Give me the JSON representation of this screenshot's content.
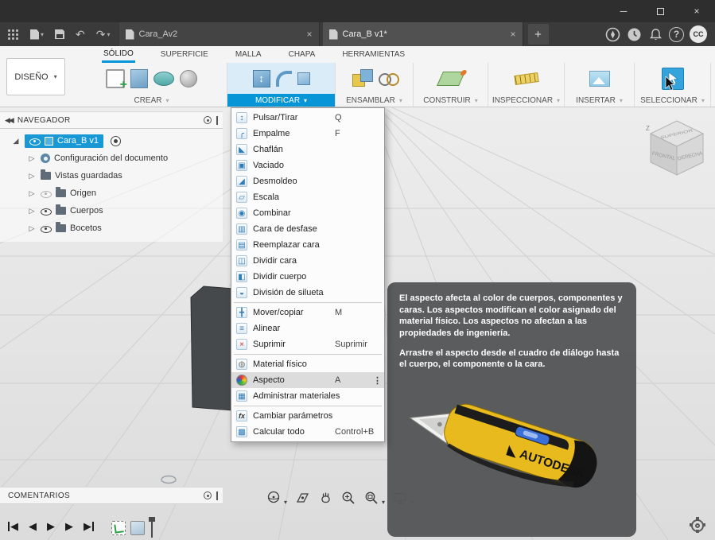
{
  "icons": {
    "caret": "▾",
    "close": "×",
    "minimize": "─",
    "new_tab": "+",
    "undo": "↶",
    "redo": "↷",
    "help": "?",
    "overflow": "⋮",
    "collapse": "◀◀",
    "play": "▶",
    "rewind": "◀"
  },
  "tabbar": {
    "tabs": [
      {
        "label": "Cara_Av2",
        "active": false
      },
      {
        "label": "Cara_B v1*",
        "active": true
      }
    ],
    "avatar": "CC"
  },
  "ribbon": {
    "design_button": "DISEÑO",
    "tabs": [
      "SÓLIDO",
      "SUPERFICIE",
      "MALLA",
      "CHAPA",
      "HERRAMIENTAS"
    ],
    "active_tab": "SÓLIDO",
    "groups": [
      {
        "label": "CREAR"
      },
      {
        "label": "MODIFICAR",
        "active": true
      },
      {
        "label": "ENSAMBLAR"
      },
      {
        "label": "CONSTRUIR"
      },
      {
        "label": "INSPECCIONAR"
      },
      {
        "label": "INSERTAR"
      },
      {
        "label": "SELECCIONAR"
      }
    ],
    "accent_color": "#0696d7"
  },
  "navigator": {
    "title": "NAVEGADOR",
    "items": [
      {
        "label": "Cara_B v1",
        "icon": "component-icon",
        "eye": "on",
        "selected": true,
        "radio": true,
        "expander": "expanded"
      },
      {
        "label": "Configuración del documento",
        "icon": "gear-icon",
        "eye": "none",
        "expander": "collapsed"
      },
      {
        "label": "Vistas guardadas",
        "icon": "folder-icon",
        "eye": "none",
        "expander": "collapsed"
      },
      {
        "label": "Origen",
        "icon": "folder-icon",
        "eye": "off",
        "expander": "collapsed"
      },
      {
        "label": "Cuerpos",
        "icon": "folder-icon",
        "eye": "on",
        "expander": "collapsed"
      },
      {
        "label": "Bocetos",
        "icon": "folder-icon",
        "eye": "on",
        "expander": "collapsed"
      }
    ]
  },
  "modify_menu": {
    "items": [
      {
        "label": "Pulsar/Tirar",
        "shortcut": "Q",
        "icon": "press-pull-icon"
      },
      {
        "label": "Empalme",
        "shortcut": "F",
        "icon": "fillet-icon"
      },
      {
        "label": "Chaflán",
        "icon": "chamfer-icon"
      },
      {
        "label": "Vaciado",
        "icon": "shell-icon"
      },
      {
        "label": "Desmoldeo",
        "icon": "draft-icon"
      },
      {
        "label": "Escala",
        "icon": "scale-icon"
      },
      {
        "label": "Combinar",
        "icon": "combine-icon"
      },
      {
        "label": "Cara de desfase",
        "icon": "offset-face-icon"
      },
      {
        "label": "Reemplazar cara",
        "icon": "replace-face-icon"
      },
      {
        "label": "Dividir cara",
        "icon": "split-face-icon"
      },
      {
        "label": "Dividir cuerpo",
        "icon": "split-body-icon"
      },
      {
        "label": "División de silueta",
        "icon": "silhouette-split-icon",
        "divider_after": true
      },
      {
        "label": "Mover/copiar",
        "shortcut": "M",
        "icon": "move-copy-icon"
      },
      {
        "label": "Alinear",
        "icon": "align-icon"
      },
      {
        "label": "Suprimir",
        "shortcut": "Suprimir",
        "icon": "delete-icon",
        "divider_after": true
      },
      {
        "label": "Material físico",
        "icon": "physical-material-icon"
      },
      {
        "label": "Aspecto",
        "shortcut": "A",
        "icon": "appearance-icon",
        "highlighted": true
      },
      {
        "label": "Administrar materiales",
        "icon": "manage-materials-icon",
        "divider_after": true
      },
      {
        "label": "Cambiar parámetros",
        "icon": "change-parameters-icon"
      },
      {
        "label": "Calcular todo",
        "shortcut": "Control+B",
        "icon": "compute-all-icon"
      }
    ]
  },
  "tooltip": {
    "paragraph1": "El aspecto afecta al color de cuerpos, componentes y caras. Los aspectos modifican el color asignado del material físico. Los aspectos no afectan a las propiedades de ingeniería.",
    "paragraph2": "Arrastre el aspecto desde el cuadro de diálogo hasta el cuerpo, el componente o la cara.",
    "brand": "AUTODESK"
  },
  "viewcube": {
    "top": "SUPERIOR",
    "left": "FRONTAL",
    "right": "DERECHA",
    "axis": "Z"
  },
  "comments": {
    "title": "COMENTARIOS"
  }
}
